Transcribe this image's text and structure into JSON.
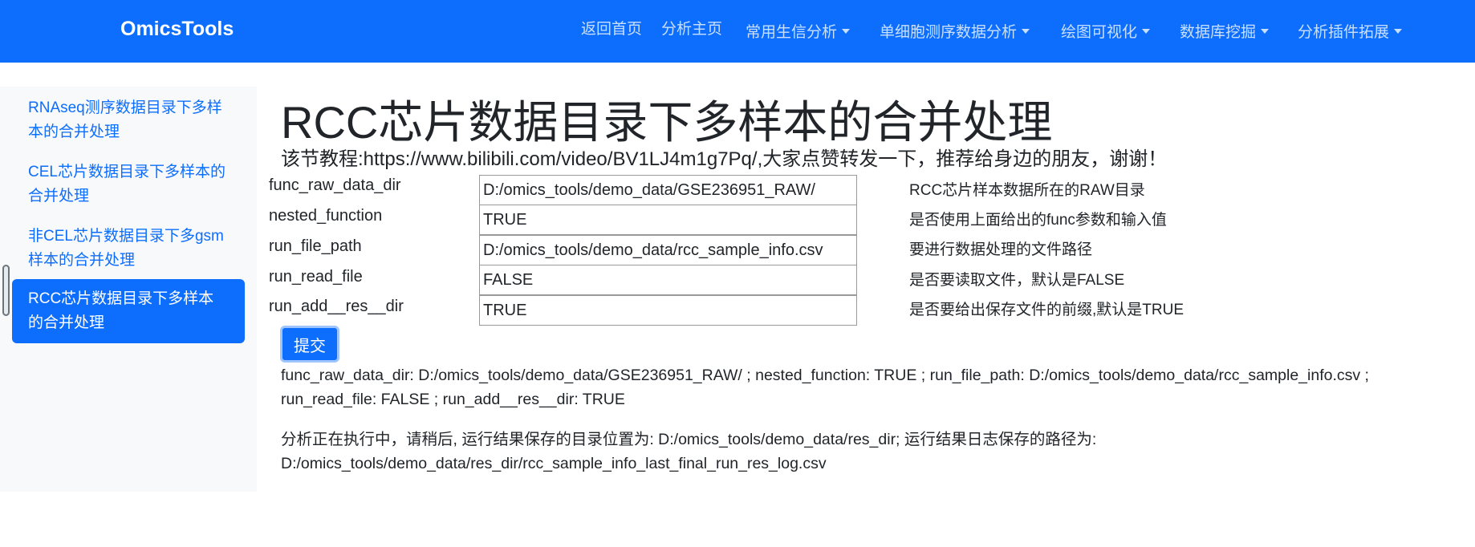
{
  "navbar": {
    "brand": "OmicsTools",
    "items": [
      {
        "label": "返回首页",
        "dropdown": false
      },
      {
        "label": "分析主页",
        "dropdown": false
      },
      {
        "label": "常用生信分析",
        "dropdown": true
      },
      {
        "label": "单细胞测序数据分析",
        "dropdown": true
      },
      {
        "label": "绘图可视化",
        "dropdown": true
      },
      {
        "label": "数据库挖掘",
        "dropdown": true
      },
      {
        "label": "分析插件拓展",
        "dropdown": true
      }
    ]
  },
  "sidebar": {
    "items": [
      {
        "label": "RNAseq测序数据目录下多样本的合并处理",
        "active": false
      },
      {
        "label": "CEL芯片数据目录下多样本的合并处理",
        "active": false
      },
      {
        "label": "非CEL芯片数据目录下多gsm样本的合并处理",
        "active": false
      },
      {
        "label": "RCC芯片数据目录下多样本的合并处理",
        "active": true
      }
    ]
  },
  "main": {
    "title": "RCC芯片数据目录下多样本的合并处理",
    "subtitle": "该节教程:https://www.bilibili.com/video/BV1LJ4m1g7Pq/,大家点赞转发一下，推荐给身边的朋友，谢谢！",
    "params": [
      {
        "name": "func_raw_data_dir",
        "value": "D:/omics_tools/demo_data/GSE236951_RAW/",
        "desc": "RCC芯片样本数据所在的RAW目录"
      },
      {
        "name": "nested_function",
        "value": "TRUE",
        "desc": "是否使用上面给出的func参数和输入值"
      },
      {
        "name": "run_file_path",
        "value": "D:/omics_tools/demo_data/rcc_sample_info.csv",
        "desc": "要进行数据处理的文件路径"
      },
      {
        "name": "run_read_file",
        "value": "FALSE",
        "desc": "是否要读取文件，默认是FALSE"
      },
      {
        "name": "run_add__res__dir",
        "value": "TRUE",
        "desc": "是否要给出保存文件的前缀,默认是TRUE"
      }
    ],
    "submit_label": "提交",
    "output_params": "func_raw_data_dir: D:/omics_tools/demo_data/GSE236951_RAW/ ; nested_function: TRUE ; run_file_path: D:/omics_tools/demo_data/rcc_sample_info.csv ; run_read_file: FALSE ; run_add__res__dir: TRUE",
    "output_status": "分析正在执行中，请稍后, 运行结果保存的目录位置为: D:/omics_tools/demo_data/res_dir; 运行结果日志保存的路径为: D:/omics_tools/demo_data/res_dir/rcc_sample_info_last_final_run_res_log.csv"
  },
  "colors": {
    "primary": "#0d6efd",
    "sidebar_bg": "#f8f9fa",
    "text": "#212529"
  }
}
